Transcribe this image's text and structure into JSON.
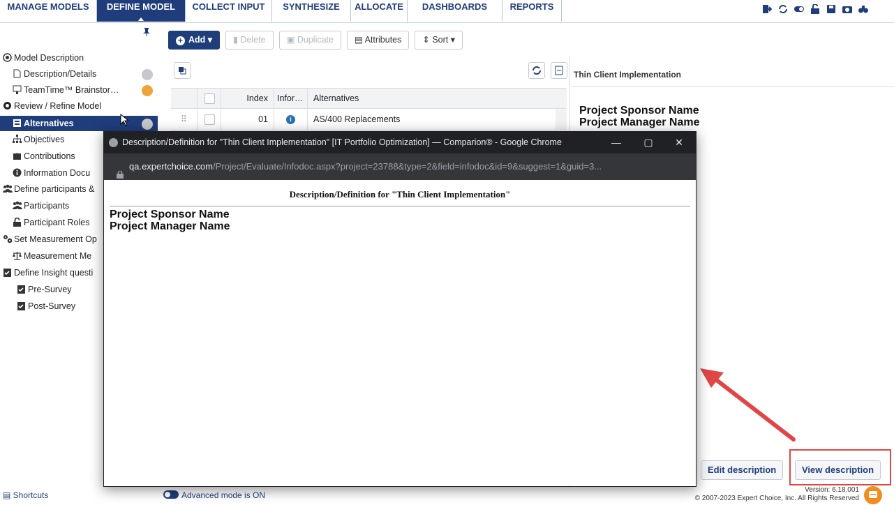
{
  "nav": {
    "tabs": [
      {
        "label": "MANAGE MODELS"
      },
      {
        "label": "DEFINE MODEL"
      },
      {
        "label": "COLLECT INPUT"
      },
      {
        "label": "SYNTHESIZE"
      },
      {
        "label": "ALLOCATE"
      },
      {
        "label": "DASHBOARDS"
      },
      {
        "label": "REPORTS"
      }
    ],
    "active_index": 1,
    "accent": "#1f3d7a"
  },
  "sidebar": {
    "items": [
      {
        "label": "Model Description",
        "icon": "target-icon"
      },
      {
        "label": "Description/Details",
        "icon": "document-icon"
      },
      {
        "label": "TeamTime™ Brainstor…",
        "icon": "presentation-icon"
      },
      {
        "label": "Review / Refine Model",
        "icon": "circle-icon"
      },
      {
        "label": "Alternatives",
        "icon": "list-icon"
      },
      {
        "label": "Objectives",
        "icon": "hierarchy-icon"
      },
      {
        "label": "Contributions",
        "icon": "puzzle-icon"
      },
      {
        "label": "Information Docu",
        "icon": "info-icon"
      },
      {
        "label": "Define participants &",
        "icon": "users-icon"
      },
      {
        "label": "Participants",
        "icon": "users-icon"
      },
      {
        "label": "Participant Roles",
        "icon": "lock-icon"
      },
      {
        "label": "Set Measurement Op",
        "icon": "gears-icon"
      },
      {
        "label": "Measurement Me",
        "icon": "scale-icon"
      },
      {
        "label": "Define Insight questi",
        "icon": "checkbook-icon"
      },
      {
        "label": "Pre-Survey",
        "icon": "checkbook-icon"
      },
      {
        "label": "Post-Survey",
        "icon": "checkbook-icon"
      }
    ]
  },
  "toolbar": {
    "add": "Add",
    "delete": "Delete",
    "duplicate": "Duplicate",
    "attributes": "Attributes",
    "sort": "Sort"
  },
  "grid": {
    "columns": [
      "Index",
      "Infor…",
      "Alternatives"
    ],
    "rows": [
      {
        "index": "01",
        "name": "AS/400 Replacements"
      }
    ]
  },
  "right_panel": {
    "title": "Thin Client Implementation",
    "lines": [
      "Project Sponsor Name",
      "Project Manager Name"
    ],
    "edit_button": "Edit description",
    "view_button": "View description"
  },
  "popup": {
    "window_title": "Description/Definition for \"Thin Client Implementation\" [IT Portfolio Optimization] — Comparion® - Google Chrome",
    "url_host": "qa.expertchoice.com",
    "url_path": "/Project/Evaluate/Infodoc.aspx?project=23788&type=2&field=infodoc&id=9&suggest=1&guid=3...",
    "heading": "Description/Definition for \"Thin Client Implementation\"",
    "lines": [
      "Project Sponsor Name",
      "Project Manager Name"
    ],
    "controls": {
      "minimize": "—",
      "maximize": "▢",
      "close": "✕"
    }
  },
  "footer": {
    "shortcuts": "Shortcuts",
    "mode": "Advanced mode is ON",
    "version": "Version: 6.18.001",
    "copyright": "© 2007-2023 Expert Choice, Inc. All Rights Reserved"
  },
  "annotation": {
    "color": "#e04646"
  }
}
